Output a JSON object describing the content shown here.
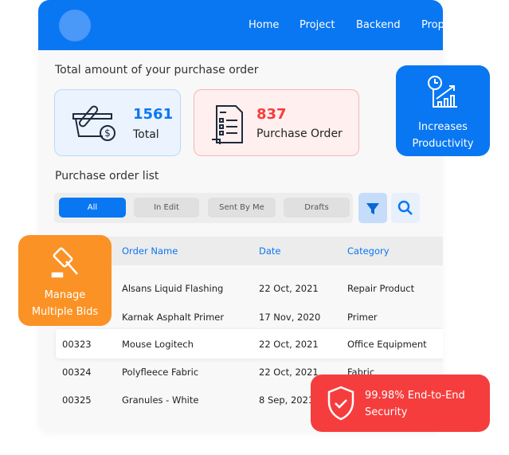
{
  "nav": {
    "items": [
      "Home",
      "Project",
      "Backend",
      "Prop"
    ]
  },
  "summary": {
    "title": "Total amount of your purchase order",
    "total": {
      "value": "1561",
      "label": "Total"
    },
    "po": {
      "value": "837",
      "label": "Purchase Order"
    }
  },
  "list": {
    "title": "Purchase order list",
    "tabs": [
      "All",
      "In Edit",
      "Sent By Me",
      "Drafts"
    ],
    "columns": [
      "Order Name",
      "Date",
      "Category"
    ],
    "rows": [
      {
        "id": "",
        "name": "Alsans Liquid Flashing",
        "date": "22 Oct, 2021",
        "category": "Repair Product"
      },
      {
        "id": "",
        "name": "Karnak Asphalt Primer",
        "date": "17 Nov, 2020",
        "category": "Primer"
      },
      {
        "id": "00323",
        "name": "Mouse Logitech",
        "date": "22 Oct, 2021",
        "category": "Office Equipment"
      },
      {
        "id": "00324",
        "name": "Polyfleece Fabric",
        "date": "22 Oct, 2021",
        "category": "Fabric"
      },
      {
        "id": "00325",
        "name": "Granules - White",
        "date": "8 Sep, 2021",
        "category": ""
      }
    ]
  },
  "badges": {
    "productivity": [
      "Increases",
      "Productivity"
    ],
    "bids": [
      "Manage",
      "Multiple Bids"
    ],
    "security": [
      "99.98% End-to-End",
      "Security"
    ]
  },
  "colors": {
    "primary": "#0a77f2",
    "red": "#f63d3d",
    "orange": "#fb9226"
  }
}
